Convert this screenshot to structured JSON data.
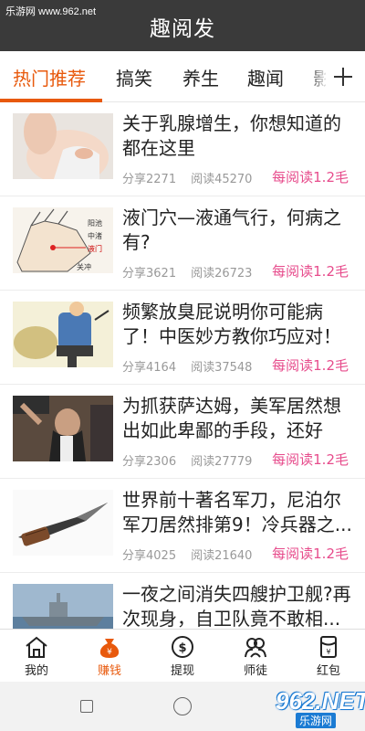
{
  "watermark": "乐游网 www.962.net",
  "header": {
    "title": "趣阅发"
  },
  "tabs": [
    {
      "label": "热门推荐"
    },
    {
      "label": "搞笑"
    },
    {
      "label": "养生"
    },
    {
      "label": "趣闻"
    },
    {
      "label": "影"
    }
  ],
  "articles": [
    {
      "title": "关于乳腺增生，你想知道的都在这里",
      "share": "分享2271",
      "read": "阅读45270",
      "reward": "每阅读1.2毛"
    },
    {
      "title": "液门穴—液通气行，何病之有?",
      "share": "分享3621",
      "read": "阅读26723",
      "reward": "每阅读1.2毛"
    },
    {
      "title": "频繁放臭屁说明你可能病了！中医妙方教你巧应对！",
      "share": "分享4164",
      "read": "阅读37548",
      "reward": "每阅读1.2毛"
    },
    {
      "title": "为抓获萨达姆，美军居然想出如此卑鄙的手段，还好他...",
      "share": "分享2306",
      "read": "阅读27779",
      "reward": "每阅读1.2毛"
    },
    {
      "title": "世界前十著名军刀，尼泊尔军刀居然排第9！冷兵器之...",
      "share": "分享4025",
      "read": "阅读21640",
      "reward": "每阅读1.2毛"
    },
    {
      "title": "一夜之间消失四艘护卫舰?再次现身，自卫队竟不敢相...",
      "share": "",
      "read": "",
      "reward": ""
    }
  ],
  "thumb_labels": {
    "a": "阳池",
    "b": "中渚",
    "c": "液门",
    "d": "关冲"
  },
  "bottom_nav": [
    {
      "label": "我的"
    },
    {
      "label": "赚钱"
    },
    {
      "label": "提现"
    },
    {
      "label": "师徒"
    },
    {
      "label": "红包"
    }
  ],
  "logo": {
    "big": "962.NET",
    "small": "乐游网"
  },
  "colors": {
    "accent": "#e8590c",
    "reward": "#e74c8c",
    "header_bg": "#3a3a3a"
  }
}
